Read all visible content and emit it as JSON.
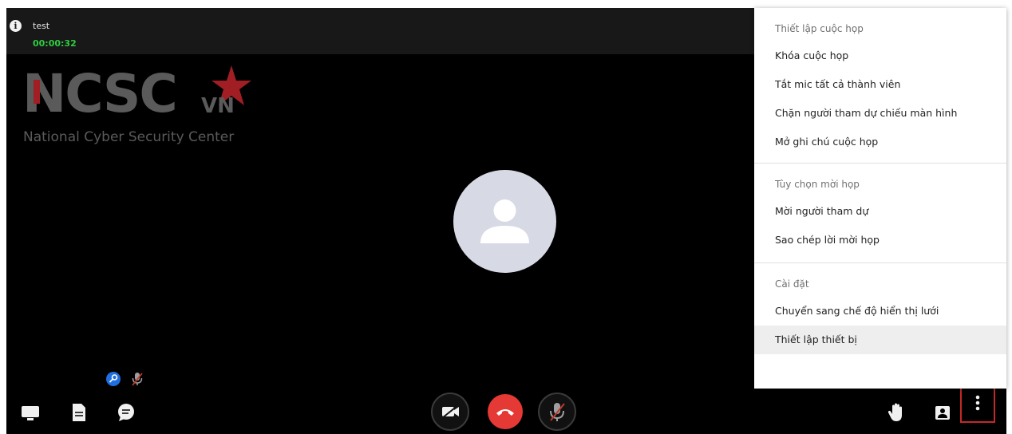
{
  "meeting": {
    "title": "test",
    "timer": "00:00:32"
  },
  "logo": {
    "name": "NCSC",
    "suffix": "VN",
    "subtitle": "National Cyber Security Center"
  },
  "colors": {
    "timer": "#2ecc40",
    "hangup": "#e53935",
    "moderator_badge": "#1f6fe0",
    "more_button_border": "#c62828",
    "logo_accent": "#a01e24"
  },
  "toolbar": {
    "left": [
      {
        "name": "screen-share-icon"
      },
      {
        "name": "document-icon"
      },
      {
        "name": "chat-icon"
      }
    ],
    "center": [
      {
        "name": "camera-off-icon"
      },
      {
        "name": "hangup-icon"
      },
      {
        "name": "mic-off-icon"
      }
    ],
    "right": [
      {
        "name": "raise-hand-icon"
      },
      {
        "name": "participants-icon"
      },
      {
        "name": "more-vertical-icon"
      }
    ]
  },
  "menu": {
    "sections": [
      {
        "header": "Thiết lập cuộc họp",
        "items": [
          "Khóa cuộc họp",
          "Tắt mic tất cả thành viên",
          "Chặn người tham dự chiếu màn hình",
          "Mở ghi chú cuộc họp"
        ]
      },
      {
        "header": "Tùy chọn mời họp",
        "items": [
          "Mời người tham dự",
          "Sao chép lời mời họp"
        ]
      },
      {
        "header": "Cài đặt",
        "items": [
          "Chuyển sang chế độ hiển thị lưới",
          "Thiết lập thiết bị"
        ]
      }
    ],
    "active_item": "Thiết lập thiết bị"
  }
}
